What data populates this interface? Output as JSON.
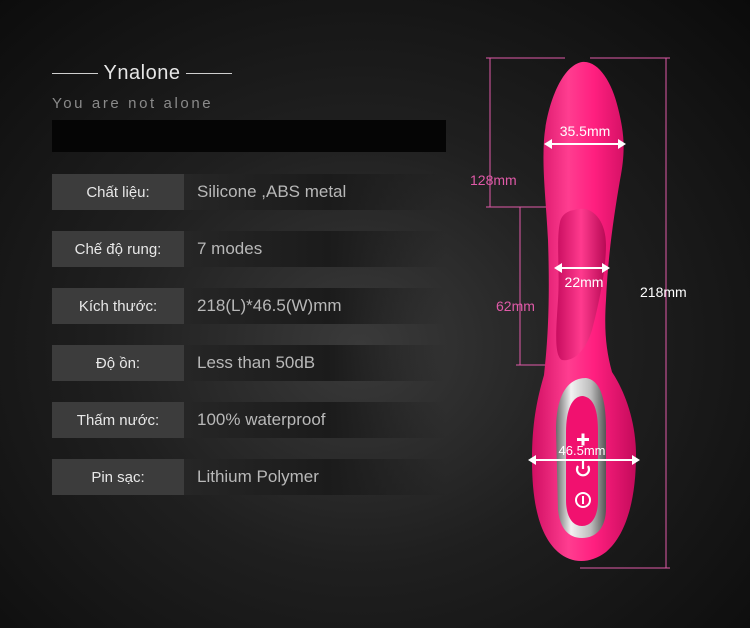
{
  "brand": {
    "name": "Ynalone",
    "tagline": "You are not alone"
  },
  "specs": [
    {
      "label": "Chất liệu:",
      "value": "Silicone ,ABS metal"
    },
    {
      "label": "Chế độ rung:",
      "value": "7 modes"
    },
    {
      "label": "Kích thước:",
      "value": "218(L)*46.5(W)mm"
    },
    {
      "label": "Độ ồn:",
      "value": "Less than 50dB"
    },
    {
      "label": "Thấm nước:",
      "value": "100% waterproof"
    },
    {
      "label": "Pin sạc:",
      "value": "Lithium Polymer"
    }
  ],
  "dimensions": {
    "tip_width": "35.5mm",
    "upper_length": "128mm",
    "arm_width": "22mm",
    "arm_length": "62mm",
    "total_length": "218mm",
    "handle_width": "46.5mm"
  },
  "colors": {
    "product": "#ff1f7f",
    "dimension_lines": "#e05aa8",
    "label_bg": "#3c3c3c"
  },
  "icons": [
    "plus-icon",
    "power-icon",
    "mode-icon"
  ]
}
